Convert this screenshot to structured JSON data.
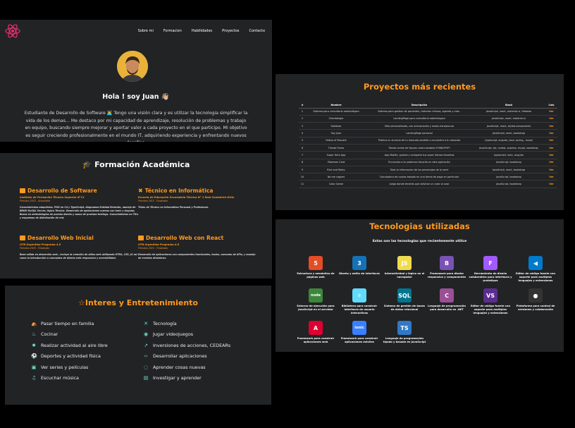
{
  "nav": {
    "links": [
      "Sobre mi",
      "Formacion",
      "Habilidades",
      "Proyectos",
      "Contacto"
    ]
  },
  "hero": {
    "title": "Hola ! soy Juan 👋🏼",
    "text": "Estudiante de Desarrollo de Software 👨‍💻 Tengo una visión clara y es utilizar la tecnologia simplificar la vida de los demas... Me destaco por mi capacidad de aprendizaje, resolución de problemas y trabajo en equipo, buscando siempre mejorar y aportar valor a cada proyecto en el que participo. Mi objetivo es seguir creciendo profesionalmente en el mundo IT, adquiriendo experiencia y enfrentando nuevos desafíos."
  },
  "formacion": {
    "title": "Formación Académica",
    "items": [
      {
        "title": "Desarrollo de Software",
        "sub": "Instituto de Formación Técnica Superior N°11",
        "date": "Periodos 2023 - Actualidad",
        "desc": "Conocimientos adquiridos, POO en C# y TypeScript, diagramas Entidad Relación, manejo de BBDD MySQL Server, lógica Técnica. Desarrollo de aplicaciones nuevas con Ionic y Angular, Bases en metodologías de prueba diseño y casos de pruebas testings. Conocimientos en TICs y esquemas de distribución de red."
      },
      {
        "title": "Técnico en Informática",
        "sub": "Escuela de Educación Secundaria Técnica N° 1 Raúl Scalabrini Ortiz",
        "date": "Periodos 2015 - Finalizado",
        "desc": "Título de Técnico en Informática Personal y Profesional."
      },
      {
        "title": "Desarrollo Web Inicial",
        "sub": "UTN Argentina Programa 4.0",
        "date": "Periodos 2023 - Finalizado",
        "desc": "Base sólida en desarrollo web , incluye la creación de sitios web utilizando HTML, CSS, JS así como la introducción a conceptos de diseño web responsivo y accesibilidad."
      },
      {
        "title": "Desarrollo Web con React",
        "sub": "UTN Argentina Programa 4.0",
        "date": "Periodos 2023 - Finalizado",
        "desc": "Desarrollo de aplicaciones con componentes funcionales, hooks, consumo de APIs, y manejo de eventos dinámicos."
      }
    ]
  },
  "intereses": {
    "title": "Interes y Entretenimiento",
    "left": [
      {
        "icon": "seedling-icon",
        "glyph": "⛺",
        "label": "Pasar tiempo en familia"
      },
      {
        "icon": "cook-icon",
        "glyph": "♨",
        "label": "Cocinar"
      },
      {
        "icon": "outdoor-icon",
        "glyph": "✹",
        "label": "Realizar actividad al aire libre"
      },
      {
        "icon": "sports-icon",
        "glyph": "⚽",
        "label": "Deportes y actividad física"
      },
      {
        "icon": "tv-icon",
        "glyph": "▣",
        "label": "Ver series y películas"
      },
      {
        "icon": "music-icon",
        "glyph": "♫",
        "label": "Escuchar música"
      }
    ],
    "right": [
      {
        "icon": "tools-icon",
        "glyph": "✕",
        "label": "Tecnología"
      },
      {
        "icon": "gamepad-icon",
        "glyph": "◉",
        "label": "Jugar videojuegos"
      },
      {
        "icon": "chart-icon",
        "glyph": "↗",
        "label": "Inversiones de acciones, CEDEARs"
      },
      {
        "icon": "code-icon",
        "glyph": "‹›",
        "label": "Desarrollar aplicaciones"
      },
      {
        "icon": "bulb-icon",
        "glyph": "◌",
        "label": "Aprender cosas nuevas"
      },
      {
        "icon": "book-icon",
        "glyph": "▤",
        "label": "Investigar y aprender"
      }
    ]
  },
  "proyectos": {
    "title": "Proyectos más recientes",
    "headers": [
      "#",
      "Nombre",
      "Descripción",
      "Stack",
      "Link"
    ],
    "rows": [
      [
        "1",
        "Sistema para consultorio odontológico",
        "Sistema para gestion de pacientes, historias clínicas, agenda y más..",
        "JavaScript, react, material-ui, firebase",
        "Ver"
      ],
      [
        "2",
        "Odontologia",
        "LandingPage para consultorio odontologico",
        "JavaScript, react, material-ui",
        "Ver"
      ],
      [
        "3",
        "Sabiduar",
        "Sitio personalizado, con animaciones y modo claro/oscuro",
        "JavaScript, react, styled-components",
        "Ver"
      ],
      [
        "4",
        "Soy Juan",
        "LandingPage personal",
        "JavaScript, react, bootstrap",
        "Ver"
      ],
      [
        "5",
        "Fedisa al Rescate",
        "Publica un anuncio de tu mascota perdida o encuentra a tu mascota",
        "typescript, angular, java, spring,, mysql",
        "Ver"
      ],
      [
        "6",
        "Tienda Funko",
        "Tienda online de figuras coleccionables FUNKOPOP!",
        "JavaScript, ejs, nodejs, express, mysql, bootstrap",
        "Ver"
      ],
      [
        "7",
        "Super Hero App",
        "App Mobile, guarda y comparte tus super héroes favoritos",
        "typescript, ionic, angular",
        "Ver"
      ],
      [
        "8",
        "Pokemon Card",
        "Encuentra a tu pokemon favorito en esta aplicación",
        "JavaScript, bootstrap",
        "Ver"
      ],
      [
        "9",
        "Rick and Morty",
        "Toda la informacion de los personajes de la serie",
        "JavaScript, react, bootstrap",
        "Ver"
      ],
      [
        "10",
        "No me cagues",
        "Calculadora de cuotas basada en una forma de pago en particular",
        "JavaScript, bootstrap",
        "Ver"
      ],
      [
        "11",
        "Color Game",
        "Juego donde tendrás que adivinar un color al azar",
        "JavaScript, bootstrap",
        "Ver"
      ]
    ]
  },
  "tecnologias": {
    "title": "Tecnologias utilizadas",
    "subtitle": "Estas son las tecnologias que recientemente utilice",
    "items": [
      {
        "icon": "html5-icon",
        "abbr": "5",
        "color": "#e44d26",
        "desc": "Estructura y semántica de páginas web"
      },
      {
        "icon": "css3-icon",
        "abbr": "3",
        "color": "#1572b6",
        "desc": "Diseño y estilo de interfaces"
      },
      {
        "icon": "javascript-icon",
        "abbr": "JS",
        "color": "#f0db4f",
        "desc": "Interactividad y lógica en el navegador"
      },
      {
        "icon": "bootstrap-icon",
        "abbr": "B",
        "color": "#7952b3",
        "desc": "Framework para diseño responsivo y componentes"
      },
      {
        "icon": "figma-icon",
        "abbr": "F",
        "color": "#a259ff",
        "desc": "Herramienta de diseño colaborativo para interfaces y prototipos"
      },
      {
        "icon": "vscode-icon",
        "abbr": "◀",
        "color": "#007acc",
        "desc": "Editor de código fuente con soporte para multiples lenguajes y extensiones"
      },
      {
        "icon": "nodejs-icon",
        "abbr": "node",
        "color": "#3c873a",
        "desc": "Entorno de ejecución para JavaScript en el servidor"
      },
      {
        "icon": "react-icon",
        "abbr": "⚛",
        "color": "#61dafb",
        "desc": "Biblioteca para construir interfaces de usuario interactivas"
      },
      {
        "icon": "mysql-icon",
        "abbr": "SQL",
        "color": "#00758f",
        "desc": "Sistema de gestión de bases de datos relacional"
      },
      {
        "icon": "csharp-icon",
        "abbr": "C",
        "color": "#9b4f96",
        "desc": "Lenguaje de programación para desarrollo en .NET"
      },
      {
        "icon": "visualstudio-icon",
        "abbr": "VS",
        "color": "#5c2d91",
        "desc": "Editor de código fuente con soporte para multiples lenguajes y extensiones"
      },
      {
        "icon": "github-icon",
        "abbr": "●",
        "color": "#333333",
        "desc": "Plataforma para control de versiones y colaboración"
      },
      {
        "icon": "angular-icon",
        "abbr": "A",
        "color": "#dd0031",
        "desc": "Framework para construir aplicaciones web"
      },
      {
        "icon": "ionic-icon",
        "abbr": "ionic",
        "color": "#3880ff",
        "desc": "Framework para construir aplicaciones móviles"
      },
      {
        "icon": "typescript-icon",
        "abbr": "TS",
        "color": "#3178c6",
        "desc": "Lenguaje de programación tipado y basado en JavaScript"
      }
    ]
  },
  "colors": {
    "accent": "#ff9a1f",
    "panel": "#222325",
    "background": "#000000",
    "logo": "#e0306a"
  }
}
